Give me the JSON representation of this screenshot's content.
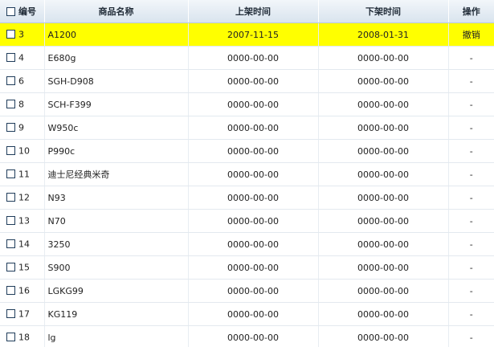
{
  "table": {
    "headers": {
      "id": "编号",
      "name": "商品名称",
      "on_shelf": "上架时间",
      "off_shelf": "下架时间",
      "action": "操作"
    },
    "rows": [
      {
        "id": "3",
        "name": "A1200",
        "on": "2007-11-15",
        "off": "2008-01-31",
        "op": "撤销",
        "highlight": true
      },
      {
        "id": "4",
        "name": "E680g",
        "on": "0000-00-00",
        "off": "0000-00-00",
        "op": "-"
      },
      {
        "id": "6",
        "name": "SGH-D908",
        "on": "0000-00-00",
        "off": "0000-00-00",
        "op": "-"
      },
      {
        "id": "8",
        "name": "SCH-F399",
        "on": "0000-00-00",
        "off": "0000-00-00",
        "op": "-"
      },
      {
        "id": "9",
        "name": "W950c",
        "on": "0000-00-00",
        "off": "0000-00-00",
        "op": "-"
      },
      {
        "id": "10",
        "name": "P990c",
        "on": "0000-00-00",
        "off": "0000-00-00",
        "op": "-"
      },
      {
        "id": "11",
        "name": "迪士尼经典米奇",
        "on": "0000-00-00",
        "off": "0000-00-00",
        "op": "-"
      },
      {
        "id": "12",
        "name": "N93",
        "on": "0000-00-00",
        "off": "0000-00-00",
        "op": "-"
      },
      {
        "id": "13",
        "name": "N70",
        "on": "0000-00-00",
        "off": "0000-00-00",
        "op": "-"
      },
      {
        "id": "14",
        "name": "3250",
        "on": "0000-00-00",
        "off": "0000-00-00",
        "op": "-"
      },
      {
        "id": "15",
        "name": "S900",
        "on": "0000-00-00",
        "off": "0000-00-00",
        "op": "-"
      },
      {
        "id": "16",
        "name": "LGKG99",
        "on": "0000-00-00",
        "off": "0000-00-00",
        "op": "-"
      },
      {
        "id": "17",
        "name": "KG119",
        "on": "0000-00-00",
        "off": "0000-00-00",
        "op": "-"
      },
      {
        "id": "18",
        "name": "lg",
        "on": "0000-00-00",
        "off": "0000-00-00",
        "op": "-"
      }
    ]
  },
  "colors": {
    "highlight_row": "#ffff00",
    "header_bg": "#d9e4ee"
  }
}
